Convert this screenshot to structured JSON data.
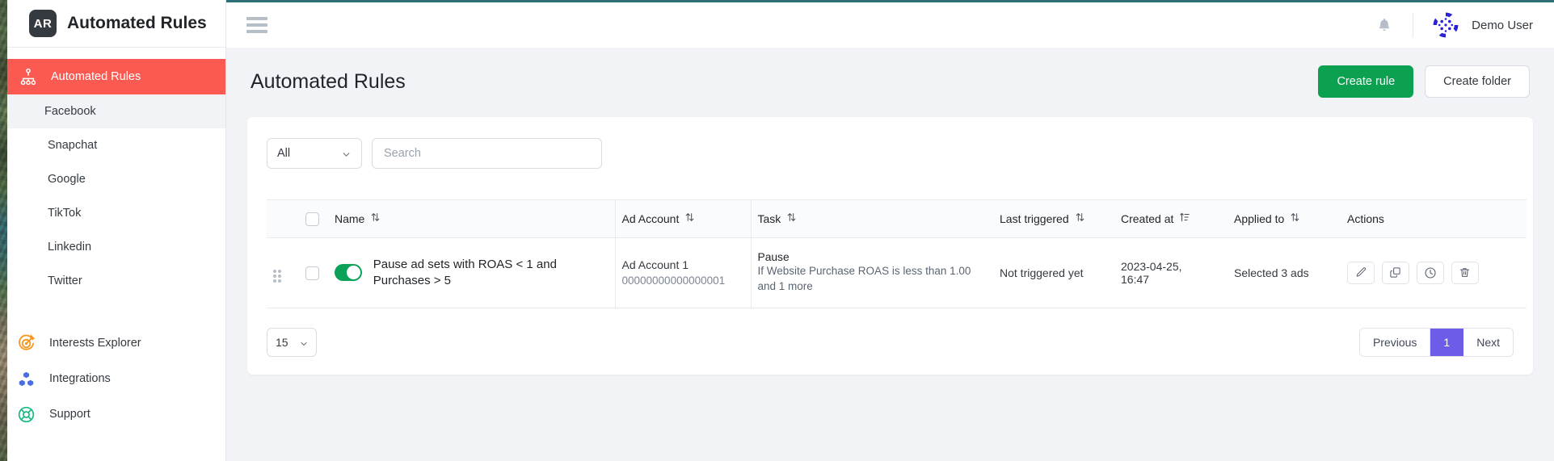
{
  "brand": {
    "logo_text": "AR",
    "title": "Automated Rules",
    "logo_icon": "ar-monogram"
  },
  "sidebar": {
    "primary": {
      "label": "Automated Rules",
      "icon": "sitemap-icon",
      "active": true
    },
    "sub_items": [
      {
        "label": "Facebook",
        "active": true
      },
      {
        "label": "Snapchat",
        "active": false
      },
      {
        "label": "Google",
        "active": false
      },
      {
        "label": "TikTok",
        "active": false
      },
      {
        "label": "Linkedin",
        "active": false
      },
      {
        "label": "Twitter",
        "active": false
      }
    ],
    "items": [
      {
        "label": "Interests Explorer",
        "icon": "target-icon",
        "color": "#f5971e"
      },
      {
        "label": "Integrations",
        "icon": "blocks-icon",
        "color": "#4a6ee0"
      },
      {
        "label": "Support",
        "icon": "lifebuoy-icon",
        "color": "#16b981"
      }
    ]
  },
  "topbar": {
    "menu_icon": "hamburger-icon",
    "bell_icon": "bell-icon",
    "avatar_icon": "user-avatar",
    "user_name": "Demo User",
    "accent_border": "#2f7078"
  },
  "header": {
    "title": "Automated Rules",
    "create_rule": "Create rule",
    "create_folder": "Create folder",
    "create_rule_color": "#0ba150"
  },
  "filters": {
    "type_select_value": "All",
    "search_placeholder": "Search",
    "search_value": ""
  },
  "table": {
    "columns": [
      {
        "label": "Name",
        "sort": "sortable"
      },
      {
        "label": "Ad Account",
        "sort": "sortable"
      },
      {
        "label": "Task",
        "sort": "sortable"
      },
      {
        "label": "Last triggered",
        "sort": "sortable"
      },
      {
        "label": "Created at",
        "sort": "sorted-asc"
      },
      {
        "label": "Applied to",
        "sort": "sortable"
      },
      {
        "label": "Actions",
        "sort": "none"
      }
    ],
    "header_checkbox_checked": false,
    "rows": [
      {
        "checked": false,
        "enabled": true,
        "name": "Pause ad sets with ROAS < 1 and Purchases > 5",
        "ad_account_name": "Ad Account 1",
        "ad_account_id": "00000000000000001",
        "task_title": "Pause",
        "task_desc": "If Website Purchase ROAS is less than 1.00 and 1 more",
        "last_triggered": "Not triggered yet",
        "created_at_date": "2023-04-25,",
        "created_at_time": "16:47",
        "applied_to": "Selected 3 ads",
        "actions": [
          {
            "name": "edit-rule-button",
            "icon": "pencil-icon"
          },
          {
            "name": "duplicate-rule-button",
            "icon": "copy-icon"
          },
          {
            "name": "rule-history-button",
            "icon": "clock-icon"
          },
          {
            "name": "delete-rule-button",
            "icon": "trash-icon"
          }
        ]
      }
    ]
  },
  "footer": {
    "page_size": "15",
    "previous": "Previous",
    "current_page": "1",
    "next": "Next",
    "current_page_color": "#6c5ce7"
  }
}
